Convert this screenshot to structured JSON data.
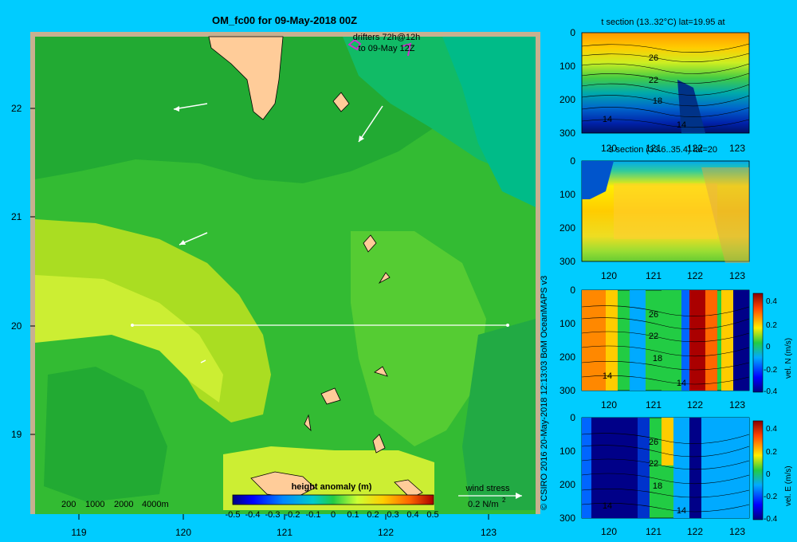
{
  "main_map": {
    "title": "OM_fc00 for 09-May-2018 00Z",
    "x_ticks": [
      "119",
      "120",
      "121",
      "122",
      "123"
    ],
    "y_ticks": [
      "22",
      "21",
      "20",
      "19"
    ],
    "drifters_label_1": "drifters 72h@12h",
    "drifters_label_2": "to 09-May 12Z",
    "depth_legend": [
      "200",
      "1000",
      "2000",
      "4000m"
    ],
    "wind_stress_label": "wind stress",
    "wind_stress_scale": "0.2 N/m",
    "wind_stress_exp": "2",
    "colorbar_title": "height anomaly  (m)",
    "colorbar_ticks": [
      "-0.5",
      "-0.4",
      "-0.3",
      "-0.2",
      "-0.1",
      "0",
      "0.1",
      "0.2",
      "0.3",
      "0.4",
      "0.5"
    ],
    "colors": {
      "background": "#00ccff",
      "land": "#ffcc99",
      "shelf": "#c8b090",
      "track": "#ffffff"
    }
  },
  "panels": [
    {
      "title": "t section (13..32°C) lat=19.95 at",
      "x_ticks": [
        "120",
        "121",
        "122",
        "123"
      ],
      "y_ticks": [
        "0",
        "100",
        "200",
        "300"
      ],
      "contour_labels": [
        "26",
        "22",
        "18",
        "14",
        "14"
      ],
      "colorbar_label": ""
    },
    {
      "title": "s section (33.6..35.4) lat=20",
      "x_ticks": [
        "120",
        "121",
        "122",
        "123"
      ],
      "y_ticks": [
        "0",
        "100",
        "200",
        "300"
      ],
      "contour_labels": [],
      "colorbar_label": ""
    },
    {
      "title": "",
      "x_ticks": [
        "120",
        "121",
        "122",
        "123"
      ],
      "y_ticks": [
        "0",
        "100",
        "200",
        "300"
      ],
      "contour_labels": [
        "26",
        "22",
        "18",
        "14",
        "14"
      ],
      "colorbar_label": "vel. N (m/s)",
      "colorbar_ticks": [
        "0.4",
        "0.2",
        "0",
        "-0.2",
        "-0.4"
      ]
    },
    {
      "title": "",
      "x_ticks": [
        "120",
        "121",
        "122",
        "123"
      ],
      "y_ticks": [
        "0",
        "100",
        "200",
        "300"
      ],
      "contour_labels": [
        "26",
        "22",
        "18",
        "14",
        "14"
      ],
      "colorbar_label": "vel. E (m/s)",
      "colorbar_ticks": [
        "0.4",
        "0.2",
        "0",
        "-0.2",
        "-0.4"
      ]
    }
  ],
  "credit": "© CSIRO 2016   20-May-2018 12:13:03 BoM OceanMAPS v3",
  "chart_data": [
    {
      "type": "heatmap",
      "title": "OM_fc00 for 09-May-2018 00Z",
      "xlabel": "",
      "ylabel": "",
      "xlim": [
        118.5,
        123.6
      ],
      "ylim": [
        18.3,
        22.7
      ],
      "colorbar": {
        "label": "height anomaly (m)",
        "range": [
          -0.5,
          0.5
        ]
      },
      "section_line": {
        "lat": 20.0,
        "lon_start": 119.5,
        "lon_end": 123.2
      }
    },
    {
      "type": "heatmap",
      "title": "t section (13..32°C) lat=19.95 at",
      "xlim": [
        119.5,
        123.2
      ],
      "ylim": [
        300,
        0
      ]
    },
    {
      "type": "heatmap",
      "title": "s section (33.6..35.4) lat=20",
      "xlim": [
        119.5,
        123.2
      ],
      "ylim": [
        300,
        0
      ]
    },
    {
      "type": "heatmap",
      "title": "",
      "xlim": [
        119.5,
        123.2
      ],
      "ylim": [
        300,
        0
      ],
      "colorbar": {
        "label": "vel. N (m/s)",
        "range": [
          -0.4,
          0.4
        ]
      }
    },
    {
      "type": "heatmap",
      "title": "",
      "xlim": [
        119.5,
        123.2
      ],
      "ylim": [
        300,
        0
      ],
      "colorbar": {
        "label": "vel. E (m/s)",
        "range": [
          -0.4,
          0.4
        ]
      }
    }
  ]
}
